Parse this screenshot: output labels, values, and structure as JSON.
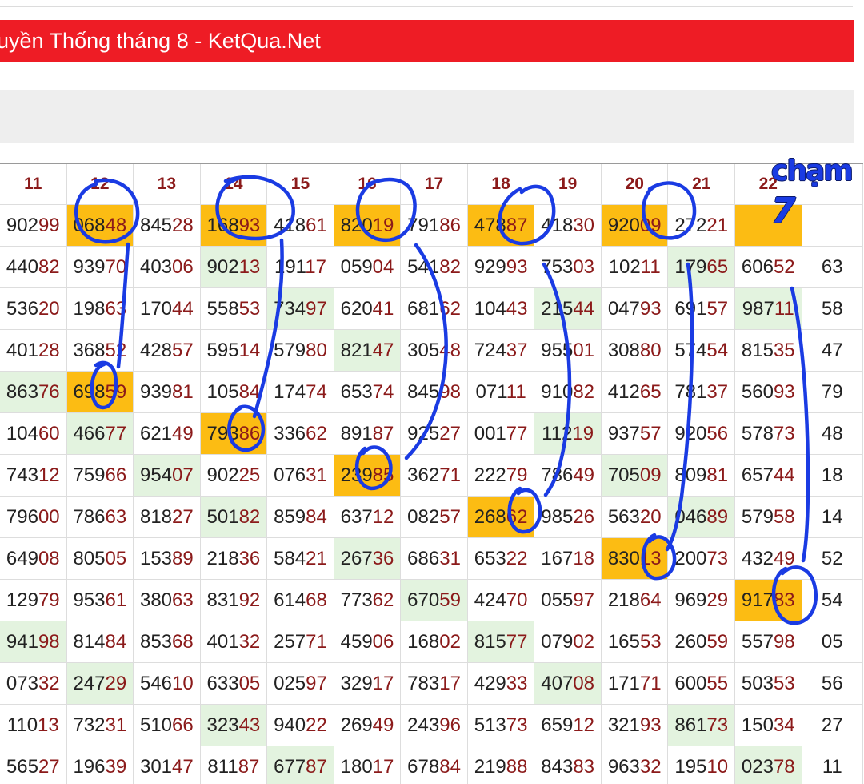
{
  "page_title": "uyền Thống tháng 8 - KetQua.Net",
  "columns": [
    "11",
    "12",
    "13",
    "14",
    "15",
    "16",
    "17",
    "18",
    "19",
    "20",
    "21",
    "22",
    ""
  ],
  "rows": [
    [
      "90299",
      "06848",
      "84528",
      "16893",
      "41861",
      "82019",
      "79186",
      "47887",
      "41830",
      "92009",
      "27221",
      "",
      ""
    ],
    [
      "44082",
      "93970",
      "40306",
      "90213",
      "19117",
      "05904",
      "54182",
      "92993",
      "75303",
      "10211",
      "17965",
      "60652",
      "63"
    ],
    [
      "53620",
      "19863",
      "17044",
      "55853",
      "73497",
      "62041",
      "68162",
      "10443",
      "21544",
      "04793",
      "69157",
      "98711",
      "58"
    ],
    [
      "40128",
      "36852",
      "42857",
      "59514",
      "57980",
      "82147",
      "30548",
      "72437",
      "95501",
      "30880",
      "57454",
      "81535",
      "47"
    ],
    [
      "86376",
      "69859",
      "93981",
      "10584",
      "17474",
      "65374",
      "84598",
      "07111",
      "91082",
      "41265",
      "78137",
      "56093",
      "79"
    ],
    [
      "10460",
      "46677",
      "62149",
      "79386",
      "33662",
      "89187",
      "92527",
      "00177",
      "11219",
      "93757",
      "92056",
      "57873",
      "48"
    ],
    [
      "74312",
      "75966",
      "95407",
      "90225",
      "07631",
      "23985",
      "36271",
      "22279",
      "78649",
      "70509",
      "80981",
      "65744",
      "18"
    ],
    [
      "79600",
      "78663",
      "81827",
      "50182",
      "85984",
      "63712",
      "08257",
      "26862",
      "98526",
      "56320",
      "04689",
      "57958",
      "14"
    ],
    [
      "64908",
      "80505",
      "15389",
      "21836",
      "58421",
      "26736",
      "68631",
      "65322",
      "16718",
      "83013",
      "20073",
      "43249",
      "52"
    ],
    [
      "12979",
      "95361",
      "38063",
      "83192",
      "61468",
      "77362",
      "67059",
      "42470",
      "05597",
      "21864",
      "96929",
      "91783",
      "54"
    ],
    [
      "94198",
      "81484",
      "85368",
      "40132",
      "25771",
      "45906",
      "16802",
      "81577",
      "07902",
      "16553",
      "26059",
      "55798",
      "05"
    ],
    [
      "07332",
      "24729",
      "54610",
      "63305",
      "02597",
      "32917",
      "78317",
      "42933",
      "40708",
      "17171",
      "60055",
      "50353",
      "56"
    ],
    [
      "11013",
      "73231",
      "51066",
      "32343",
      "94022",
      "26949",
      "24396",
      "51373",
      "65912",
      "32193",
      "86173",
      "15034",
      "27"
    ],
    [
      "56527",
      "19639",
      "30147",
      "81187",
      "67787",
      "18017",
      "67884",
      "21988",
      "84383",
      "96332",
      "19510",
      "02378",
      "11"
    ]
  ],
  "cell_colors": [
    [
      "",
      "o",
      "",
      "o",
      "",
      "o",
      "",
      "o",
      "",
      "o",
      "",
      "o",
      ""
    ],
    [
      "",
      "",
      "",
      "g",
      "",
      "",
      "",
      "",
      "",
      "",
      "g",
      "",
      ""
    ],
    [
      "",
      "",
      "",
      "",
      "g",
      "",
      "",
      "",
      "g",
      "",
      "",
      "g",
      ""
    ],
    [
      "",
      "",
      "",
      "",
      "",
      "g",
      "",
      "",
      "",
      "",
      "",
      "",
      ""
    ],
    [
      "g",
      "o",
      "",
      "",
      "",
      "",
      "",
      "",
      "",
      "",
      "",
      "",
      ""
    ],
    [
      "",
      "g",
      "",
      "o",
      "",
      "",
      "",
      "",
      "g",
      "",
      "",
      "",
      ""
    ],
    [
      "",
      "",
      "g",
      "",
      "",
      "o",
      "",
      "",
      "",
      "g",
      "",
      "",
      ""
    ],
    [
      "",
      "",
      "",
      "g",
      "",
      "",
      "",
      "o",
      "",
      "",
      "g",
      "",
      ""
    ],
    [
      "",
      "",
      "",
      "",
      "",
      "g",
      "",
      "",
      "",
      "o",
      "",
      "",
      ""
    ],
    [
      "",
      "",
      "",
      "",
      "",
      "",
      "g",
      "",
      "",
      "",
      "",
      "o",
      ""
    ],
    [
      "g",
      "",
      "",
      "",
      "",
      "",
      "",
      "g",
      "",
      "",
      "",
      "",
      ""
    ],
    [
      "",
      "g",
      "",
      "",
      "",
      "",
      "",
      "",
      "g",
      "",
      "",
      "",
      ""
    ],
    [
      "",
      "",
      "",
      "g",
      "",
      "",
      "",
      "",
      "",
      "",
      "g",
      "",
      ""
    ],
    [
      "",
      "",
      "",
      "",
      "g",
      "",
      "",
      "",
      "",
      "",
      "",
      "g",
      ""
    ]
  ],
  "colors": {
    "title_bg": "#ee1c25",
    "highlight_orange": "#fcbc13",
    "highlight_green": "#e3f3df",
    "annotation_blue": "#1a3be3",
    "tail_digits": "#8b1a1a"
  },
  "annotation": {
    "label_word": "chạm",
    "label_digit": "7"
  }
}
